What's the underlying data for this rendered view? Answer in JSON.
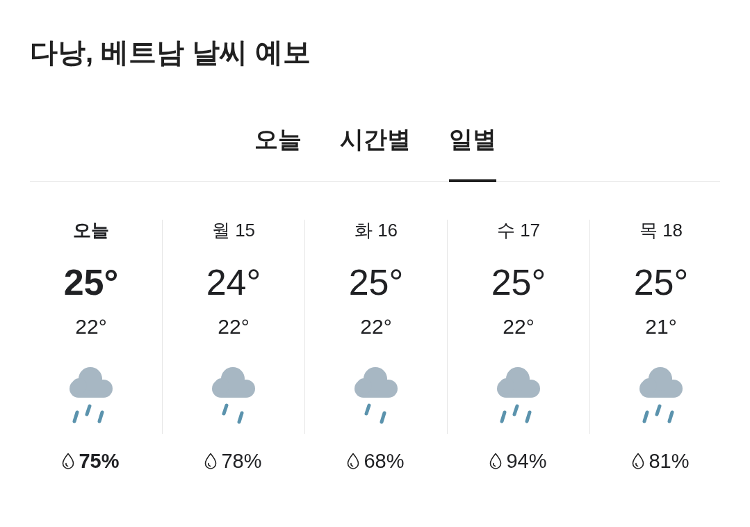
{
  "title": "다낭, 베트남 날씨 예보",
  "tabs": [
    {
      "label": "오늘",
      "selected": false
    },
    {
      "label": "시간별",
      "selected": false
    },
    {
      "label": "일별",
      "selected": true
    }
  ],
  "days": [
    {
      "label": "오늘",
      "selected": true,
      "high": "25°",
      "low": "22°",
      "kind": "heavy-rain",
      "precipitation": "75%"
    },
    {
      "label": "월 15",
      "selected": false,
      "high": "24°",
      "low": "22°",
      "kind": "rain",
      "precipitation": "78%"
    },
    {
      "label": "화 16",
      "selected": false,
      "high": "25°",
      "low": "22°",
      "kind": "rain",
      "precipitation": "68%"
    },
    {
      "label": "수 17",
      "selected": false,
      "high": "25°",
      "low": "22°",
      "kind": "heavy-rain",
      "precipitation": "94%"
    },
    {
      "label": "목 18",
      "selected": false,
      "high": "25°",
      "low": "21°",
      "kind": "heavy-rain",
      "precipitation": "81%"
    }
  ]
}
